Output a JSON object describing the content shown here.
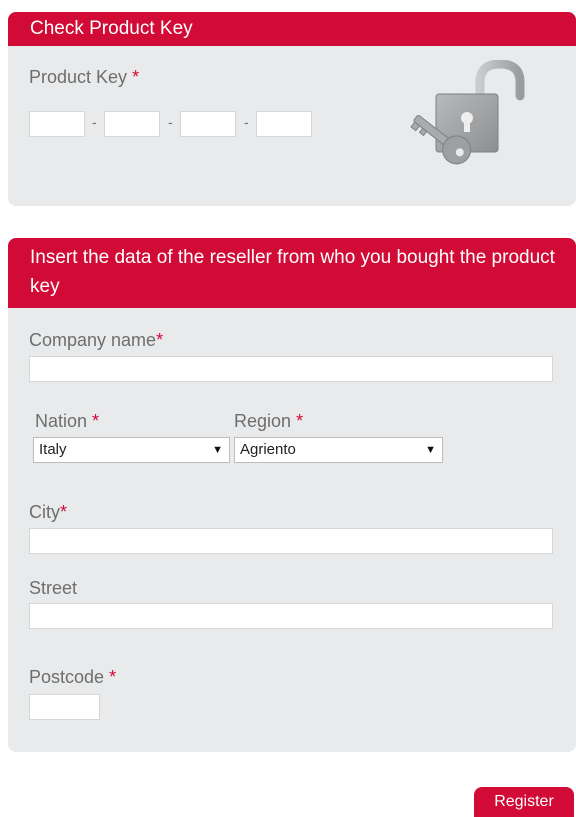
{
  "check_key_panel": {
    "title": "Check Product Key",
    "product_key_label": "Product Key",
    "required_mark": "*",
    "separator": "-",
    "key_segments": [
      "",
      "",
      "",
      ""
    ],
    "illustration": "unlocked-padlock-with-key-icon"
  },
  "reseller_panel": {
    "title": "Insert the data of the reseller from who you bought the product key",
    "company_label": "Company name",
    "company_value": "",
    "nation_label": "Nation",
    "nation_value": "Italy",
    "region_label": "Region",
    "region_value": "Agriento",
    "city_label": "City",
    "city_value": "",
    "street_label": "Street",
    "street_value": "",
    "postcode_label": "Postcode",
    "postcode_value": "",
    "required_mark": "*",
    "select_arrow": "▼"
  },
  "actions": {
    "register_label": "Register"
  },
  "colors": {
    "accent": "#d10a36",
    "panel_bg": "#e9eaeb",
    "label": "#6e6e6e"
  }
}
